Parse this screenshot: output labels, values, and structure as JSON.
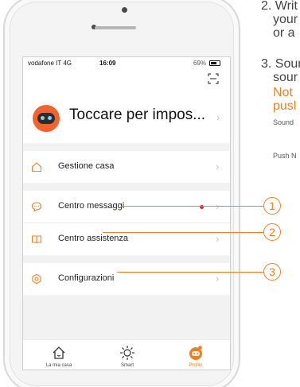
{
  "status_bar": {
    "carrier": "vodafone IT  4G",
    "time": "16:09",
    "battery_text": "69%",
    "battery_level": 0.69
  },
  "profile": {
    "name": "Toccare per impos..."
  },
  "menu": {
    "items": [
      {
        "label": "Gestione casa",
        "icon": "home-outline-icon"
      },
      {
        "label": "Centro messaggi",
        "icon": "chat-bubble-icon",
        "unread_dot": true
      },
      {
        "label": "Centro assistenza",
        "icon": "book-icon"
      },
      {
        "label": "Configurazioni",
        "icon": "settings-hex-icon"
      }
    ]
  },
  "tabs": [
    {
      "label": "La mia casa",
      "icon": "home-icon",
      "active": false
    },
    {
      "label": "Smart",
      "icon": "sun-icon",
      "active": false
    },
    {
      "label": "Profilo",
      "icon": "profile-icon",
      "active": true
    }
  ],
  "callouts": [
    "1",
    "2",
    "3"
  ],
  "side_text": {
    "step2_line1": "2. Writ",
    "step2_line2": "your",
    "step2_line3": "or a",
    "step3_line1": "3. Sour",
    "step3_line2": "sour",
    "note_line1": "Not",
    "note_line2": "pusl",
    "sound_label": "Sound",
    "push_label": "Push N"
  },
  "colors": {
    "accent": "#f07f1e",
    "avatar": "#f5622c",
    "unread": "#e0252f"
  }
}
